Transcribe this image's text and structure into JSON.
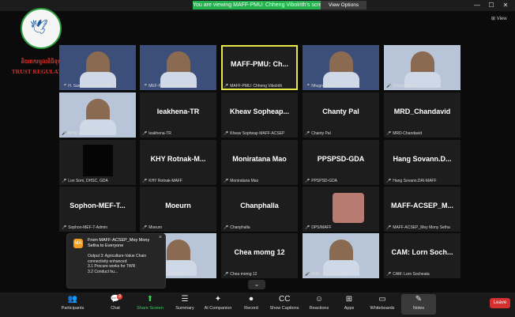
{
  "topbar": {
    "viewing_text": "You are viewing MAFF-PMU: Chheng Vibolrith's screen",
    "view_options": "View Options",
    "min_icon": "minimize-icon",
    "max_icon": "maximize-icon",
    "close_icon": "close-icon"
  },
  "logo": {
    "khmer_text": "និយតករមូលនិធិទុក",
    "english_text": "TRUST REGULATOR"
  },
  "view_button": "View",
  "tiles": [
    {
      "name": "",
      "label": "H. Sam Ang MEF-FGMP",
      "kind": "video"
    },
    {
      "name": "",
      "label": "MEF-PIU SF-Hay Sopaima",
      "kind": "video"
    },
    {
      "name": "MAFF-PMU: Ch...",
      "label": "MAFF-PMU: Chheng Vibolrith",
      "kind": "name",
      "active": true
    },
    {
      "name": "",
      "label": "Nhugnbith leth",
      "kind": "video"
    },
    {
      "name": "",
      "label": "Sokal Chea",
      "kind": "video-light"
    },
    {
      "name": "",
      "label": "MHD Sophea",
      "kind": "video-light"
    },
    {
      "name": "leakhena-TR",
      "label": "leakhena-TR",
      "kind": "name"
    },
    {
      "name": "Kheav Sopheap...",
      "label": "Kheav Sopheap MAFF-ACSEP",
      "kind": "name"
    },
    {
      "name": "Chanty Pal",
      "label": "Chanty Pal",
      "kind": "name"
    },
    {
      "name": "MRD_Chandavid",
      "label": "MRD-Chandavid",
      "kind": "name"
    },
    {
      "name": "",
      "label": "Lon Som, DHSC, GDA",
      "kind": "black"
    },
    {
      "name": "KHY Rotnak-M...",
      "label": "KHY Rotnak-MAFF",
      "kind": "name"
    },
    {
      "name": "Moniratana Mao",
      "label": "Moniratana Mao",
      "kind": "name"
    },
    {
      "name": "PPSPSD-GDA",
      "label": "PPSPSD-GDA",
      "kind": "name"
    },
    {
      "name": "Hang Sovann.D...",
      "label": "Hang Sovann.DAI-MAFF",
      "kind": "name"
    },
    {
      "name": "Sophon-MEF-T...",
      "label": "Sophon-MEF-T-Admin",
      "kind": "name"
    },
    {
      "name": "Moeurn",
      "label": "Moeurn",
      "kind": "name"
    },
    {
      "name": "Chanphalla",
      "label": "Chanphalla",
      "kind": "name"
    },
    {
      "name": "",
      "label": "DPS/MAFF",
      "kind": "pink"
    },
    {
      "name": "MAFF-ACSEP_M...",
      "label": "MAFF-ACSEP_Mey Mony Setha",
      "kind": "name"
    },
    {
      "name": "",
      "label": "",
      "kind": "hidden"
    },
    {
      "name": "",
      "label": "Keo Kong (DAI/MAFF)",
      "kind": "video-light"
    },
    {
      "name": "Chea momg 12",
      "label": "Chea momg 12",
      "kind": "name"
    },
    {
      "name": "",
      "label": "ADB - Manisha Dhole",
      "kind": "video-light"
    },
    {
      "name": "CAM: Lorn Soch...",
      "label": "CAM: Lorn Socheata",
      "kind": "name"
    }
  ],
  "chat_popup": {
    "avatar": "MA",
    "from": "From MAFF-ACSEP_Mey Mony Setha to Everyone",
    "message": "Output 3: Agriculture-Value Chain connectivity enhanced\n3.1 Procure works for TWR\n3.2 Conduct hu..."
  },
  "chat_badge": "3",
  "toolbar": [
    {
      "icon": "participants-icon",
      "glyph": "👥",
      "label": "Participants"
    },
    {
      "icon": "chat-icon",
      "glyph": "💬",
      "label": "Chat"
    },
    {
      "icon": "share-screen-icon",
      "glyph": "⬆",
      "label": "Share Screen"
    },
    {
      "icon": "summary-icon",
      "glyph": "☰",
      "label": "Summary"
    },
    {
      "icon": "ai-companion-icon",
      "glyph": "✦",
      "label": "AI Companion"
    },
    {
      "icon": "record-icon",
      "glyph": "⏺",
      "label": "Record"
    },
    {
      "icon": "show-captions-icon",
      "glyph": "CC",
      "label": "Show Captions"
    },
    {
      "icon": "reactions-icon",
      "glyph": "☺",
      "label": "Reactions"
    },
    {
      "icon": "apps-icon",
      "glyph": "⊞",
      "label": "Apps"
    },
    {
      "icon": "whiteboards-icon",
      "glyph": "▭",
      "label": "Whiteboards"
    },
    {
      "icon": "notes-icon",
      "glyph": "✎",
      "label": "Notes"
    }
  ],
  "leave": "Leave",
  "colors": {
    "accent_green": "#22b14c",
    "leave_red": "#d3302f",
    "active_border": "#e6e84a"
  }
}
